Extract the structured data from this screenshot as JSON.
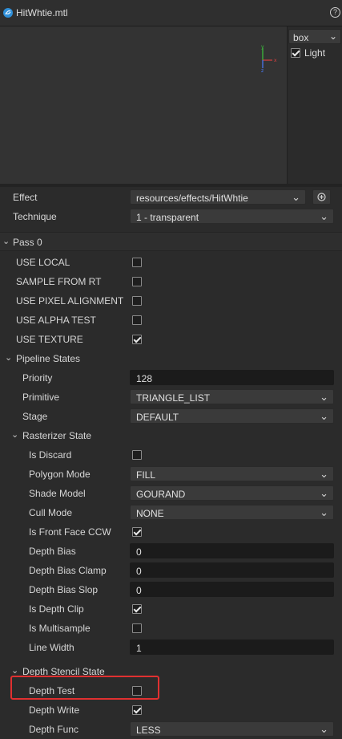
{
  "title": {
    "filename": "HitWhtie.mtl",
    "file_icon": "material-icon",
    "help_icon": "help-icon"
  },
  "preview": {
    "mesh_select": "box",
    "light_label": "Light",
    "light_checked": true,
    "gizmo_axes": {
      "x": "x",
      "y": "y",
      "z": "z"
    }
  },
  "material": {
    "effect_label": "Effect",
    "effect_value": "resources/effects/HitWhtie",
    "technique_label": "Technique",
    "technique_value": "1 - transparent"
  },
  "pass": {
    "header": "Pass 0",
    "defines": [
      {
        "label": "USE LOCAL",
        "checked": false
      },
      {
        "label": "SAMPLE FROM RT",
        "checked": false
      },
      {
        "label": "USE PIXEL ALIGNMENT",
        "checked": false
      },
      {
        "label": "USE ALPHA TEST",
        "checked": false
      },
      {
        "label": "USE TEXTURE",
        "checked": true
      }
    ],
    "pipeline": {
      "header": "Pipeline States",
      "priority_label": "Priority",
      "priority_value": "128",
      "primitive_label": "Primitive",
      "primitive_value": "TRIANGLE_LIST",
      "stage_label": "Stage",
      "stage_value": "DEFAULT",
      "rasterizer": {
        "header": "Rasterizer State",
        "is_discard_label": "Is Discard",
        "is_discard": false,
        "polygon_mode_label": "Polygon Mode",
        "polygon_mode": "FILL",
        "shade_model_label": "Shade Model",
        "shade_model": "GOURAND",
        "cull_mode_label": "Cull Mode",
        "cull_mode": "NONE",
        "front_ccw_label": "Is Front Face CCW",
        "front_ccw": true,
        "depth_bias_label": "Depth Bias",
        "depth_bias": "0",
        "depth_bias_clamp_label": "Depth Bias Clamp",
        "depth_bias_clamp": "0",
        "depth_bias_slop_label": "Depth Bias Slop",
        "depth_bias_slop": "0",
        "depth_clip_label": "Is Depth Clip",
        "depth_clip": true,
        "multisample_label": "Is Multisample",
        "multisample": false,
        "line_width_label": "Line Width",
        "line_width": "1"
      },
      "depth_stencil": {
        "header": "Depth Stencil State",
        "depth_test_label": "Depth Test",
        "depth_test": false,
        "depth_write_label": "Depth Write",
        "depth_write": true,
        "depth_func_label": "Depth Func",
        "depth_func": "LESS"
      }
    }
  },
  "colors": {
    "highlight": "#e03030",
    "background": "#2b2b2b",
    "field": "#1b1b1b"
  }
}
